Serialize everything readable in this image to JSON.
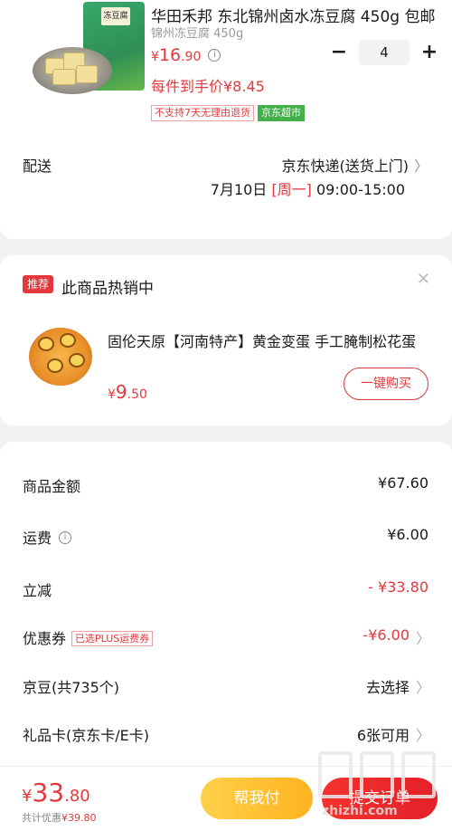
{
  "product": {
    "title": "华田禾邦 东北锦州卤水冻豆腐 450g 包邮",
    "spec": "锦州冻豆腐 450g",
    "price_yen": "¥",
    "price_int": "16",
    "price_dec": ".90",
    "quantity": "4",
    "final_price": "每件到手价¥8.45",
    "tag_no_return": "不支持7天无理由退货",
    "tag_supermarket": "京东超市",
    "pack_label": "冻豆腐"
  },
  "shipping": {
    "label": "配送",
    "method": "京东快递(送货上门)",
    "date": "7月10日",
    "weekday": "[周一]",
    "time": "09:00-15:00"
  },
  "recommend": {
    "badge": "推荐",
    "heading": "此商品热销中",
    "item_title": "固伦天原【河南特产】黄金变蛋 手工腌制松花蛋",
    "price_yen": "¥",
    "price_int": "9",
    "price_dec": ".50",
    "buy_label": "一键购买"
  },
  "summary": {
    "rows": [
      {
        "label": "商品金额",
        "value": "¥67.60"
      },
      {
        "label": "运费",
        "value": "¥6.00"
      },
      {
        "label": "立减",
        "value": "- ¥33.80"
      },
      {
        "label": "优惠券",
        "tag": "已选PLUS运费券",
        "value": "-¥6.00"
      },
      {
        "label": "京豆(共735个)",
        "value": "去选择"
      },
      {
        "label": "礼品卡(京东卡/E卡)",
        "value": "6张可用"
      }
    ]
  },
  "bottom": {
    "total_yen": "¥",
    "total_int": "33",
    "total_dec": ".80",
    "saving_label": "共计优惠",
    "saving_amount": "¥39.80",
    "help_pay_label": "帮我付",
    "submit_label": "提交订单"
  },
  "watermark": {
    "text": "zhizhi.com",
    "mark": "值"
  },
  "colors": {
    "accent_red": "#e4393c",
    "supermarket_green": "#43b14a",
    "help_pay_yellow": "#ffc12e"
  }
}
